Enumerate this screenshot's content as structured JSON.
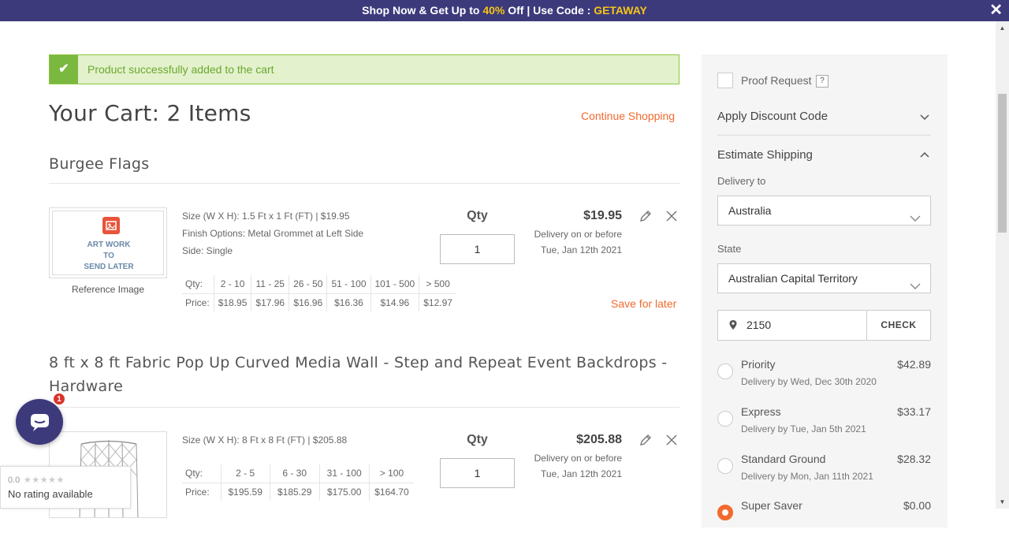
{
  "promo": {
    "prefix": "Shop Now & Get Up to ",
    "percent": "40%",
    "middle": " Off | Use Code : ",
    "code": "GETAWAY",
    "close": "✕"
  },
  "alert": {
    "message": "Product successfully added to the cart"
  },
  "cart": {
    "title": "Your Cart: 2 Items",
    "continue_label": "Continue Shopping",
    "items": [
      {
        "name": "Burgee Flags",
        "thumb_text": [
          "ART WORK",
          "TO",
          "SEND LATER"
        ],
        "thumb_label": "Reference Image",
        "attributes": [
          "Size (W X H): 1.5 Ft x 1 Ft (FT) | $19.95",
          "Finish Options: Metal Grommet at Left Side",
          "Side: Single"
        ],
        "tiers": {
          "qty_label": "Qty:",
          "price_label": "Price:",
          "qty": [
            "2 - 10",
            "11 - 25",
            "26 - 50",
            "51 - 100",
            "101 - 500",
            "> 500"
          ],
          "price": [
            "$18.95",
            "$17.96",
            "$16.96",
            "$16.36",
            "$14.96",
            "$12.97"
          ]
        },
        "qty_heading": "Qty",
        "qty": "1",
        "price": "$19.95",
        "delivery_line1": "Delivery on or before",
        "delivery_line2": "Tue, Jan 12th 2021",
        "save_later": "Save for later"
      },
      {
        "name_line1": "8 ft x 8 ft Fabric Pop Up Curved Media Wall - Step and Repeat Event Backdrops -",
        "name_line2": "Hardware",
        "attributes": [
          "Size (W X H): 8 Ft x 8 Ft (FT) | $205.88"
        ],
        "tiers": {
          "qty_label": "Qty:",
          "price_label": "Price:",
          "qty": [
            "2 - 5",
            "6 - 30",
            "31 - 100",
            "> 100"
          ],
          "price": [
            "$195.59",
            "$185.29",
            "$175.00",
            "$164.70"
          ]
        },
        "qty_heading": "Qty",
        "qty": "1",
        "price": "$205.88",
        "delivery_line1": "Delivery on or before",
        "delivery_line2": "Tue, Jan 12th 2021"
      }
    ]
  },
  "sidebar": {
    "proof_label": "Proof Request",
    "proof_help": "?",
    "discount_label": "Apply Discount Code",
    "shipping_label": "Estimate Shipping",
    "delivery_to_label": "Delivery to",
    "country": "Australia",
    "state_label": "State",
    "state": "Australian Capital Territory",
    "zip": "2150",
    "check_label": "CHECK",
    "options": [
      {
        "name": "Priority",
        "cost": "$42.89",
        "when": "Delivery by Wed, Dec 30th 2020",
        "selected": false
      },
      {
        "name": "Express",
        "cost": "$33.17",
        "when": "Delivery by Tue, Jan 5th 2021",
        "selected": false
      },
      {
        "name": "Standard Ground",
        "cost": "$28.32",
        "when": "Delivery by Mon, Jan 11th 2021",
        "selected": false
      },
      {
        "name": "Super Saver",
        "cost": "$0.00",
        "when": "",
        "selected": true
      }
    ]
  },
  "chat": {
    "badge": "1"
  },
  "rating": {
    "score": "0.0",
    "stars": "★★★★★",
    "text": "No rating available"
  },
  "colors": {
    "brand": "#3d3a7c",
    "accent": "#f26a2e",
    "success": "#7ab840",
    "promo_highlight": "#f5c518"
  }
}
